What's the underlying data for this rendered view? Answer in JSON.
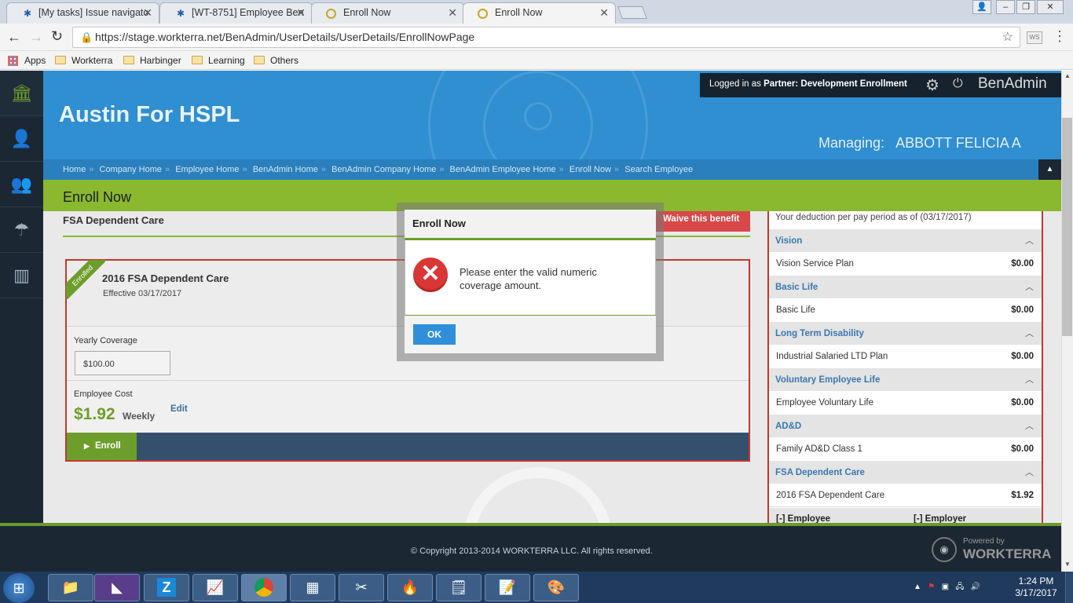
{
  "browser": {
    "tabs": [
      {
        "label": "[My tasks] Issue navigato",
        "icon": "jira-icon"
      },
      {
        "label": "[WT-8751] Employee Ben",
        "icon": "jira-icon"
      },
      {
        "label": "Enroll Now",
        "icon": "workterra-icon"
      },
      {
        "label": "Enroll Now",
        "icon": "workterra-icon",
        "active": true
      }
    ],
    "url": "https://stage.workterra.net/BenAdmin/UserDetails/UserDetails/EnrollNowPage",
    "bookmarks": [
      "Apps",
      "Workterra",
      "Harbinger",
      "Learning",
      "Others"
    ]
  },
  "header": {
    "company": "Austin For HSPL",
    "logged_in_prefix": "Logged in as",
    "partner_label": "Partner:",
    "partner_name": "Development Enrollment",
    "app_name": "BenAdmin",
    "managing_label": "Managing:",
    "managing_name": "ABBOTT FELICIA A"
  },
  "breadcrumbs": [
    "Home",
    "Company Home",
    "Employee Home",
    "BenAdmin Home",
    "BenAdmin Company Home",
    "BenAdmin Employee Home",
    "Enroll Now",
    "Search Employee"
  ],
  "page_title": "Enroll Now",
  "enroll": {
    "section_title": "FSA Dependent Care",
    "waive_label": "Waive this benefit",
    "ribbon": "Enrolled",
    "plan_name": "2016 FSA Dependent Care",
    "effective": "Effective 03/17/2017",
    "yearly_label": "Yearly Coverage",
    "yearly_value": "$100.00",
    "cost_label": "Employee Cost",
    "cost_value": "$1.92",
    "cost_period": "Weekly",
    "edit_label": "Edit",
    "enroll_button": "Enroll"
  },
  "side_panel": {
    "heading": "Your deduction per pay period as of (03/17/2017)",
    "sections": [
      {
        "name": "Vision",
        "plan": "Vision Service Plan",
        "amount": "$0.00"
      },
      {
        "name": "Basic Life",
        "plan": "Basic Life",
        "amount": "$0.00"
      },
      {
        "name": "Long Term Disability",
        "plan": "Industrial Salaried LTD Plan",
        "amount": "$0.00"
      },
      {
        "name": "Voluntary Employee Life",
        "plan": "Employee Voluntary Life",
        "amount": "$0.00"
      },
      {
        "name": "AD&D",
        "plan": "Family AD&D Class 1",
        "amount": "$0.00"
      },
      {
        "name": "FSA Dependent Care",
        "plan": "2016 FSA Dependent Care",
        "amount": "$1.92"
      }
    ],
    "footer_employee": "[-] Employee",
    "footer_employer": "[-] Employer"
  },
  "modal": {
    "title": "Enroll Now",
    "message": "Please enter the valid numeric coverage amount.",
    "ok_label": "OK"
  },
  "footer": {
    "copyright": "© Copyright 2013-2014 WORKTERRA LLC. All rights reserved.",
    "powered_by": "Powered by",
    "brand": "WORKTERRA"
  },
  "taskbar": {
    "time": "1:24 PM",
    "date": "3/17/2017"
  },
  "colors": {
    "header_blue": "#2f8fd0",
    "accent_green": "#8ab82f",
    "error_red": "#d93636",
    "ok_blue": "#2f8fd8"
  }
}
